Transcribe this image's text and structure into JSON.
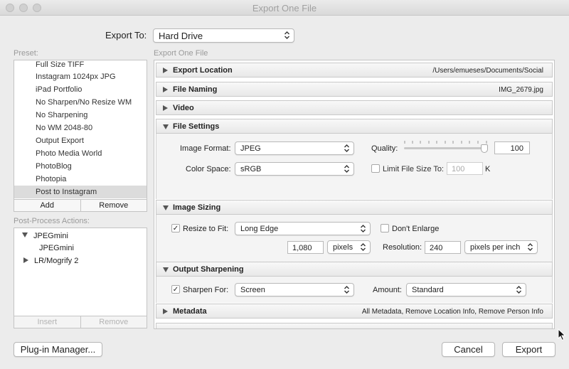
{
  "window": {
    "title": "Export One File"
  },
  "export_to": {
    "label": "Export To:",
    "value": "Hard Drive"
  },
  "preset": {
    "label": "Preset:",
    "items": [
      "Full Size TIFF",
      "Instagram 1024px JPG",
      "iPad Portfolio",
      "No Sharpen/No Resize WM",
      "No Sharpening",
      "No WM 2048-80",
      "Output Export",
      "Photo Media World",
      "PhotoBlog",
      "Photopia",
      "Post to Instagram"
    ],
    "selected": "Post to Instagram",
    "add_label": "Add",
    "remove_label": "Remove"
  },
  "post_process": {
    "label": "Post-Process Actions:",
    "items": [
      "JPEGmini",
      "JPEGmini",
      "LR/Mogrify 2"
    ],
    "insert_label": "Insert",
    "remove_label": "Remove"
  },
  "main": {
    "label": "Export One File",
    "sections": {
      "export_location": {
        "title": "Export Location",
        "summary": "/Users/emueses/Documents/Social"
      },
      "file_naming": {
        "title": "File Naming",
        "summary": "IMG_2679.jpg"
      },
      "video": {
        "title": "Video"
      },
      "file_settings": {
        "title": "File Settings",
        "image_format_label": "Image Format:",
        "image_format": "JPEG",
        "quality_label": "Quality:",
        "quality": "100",
        "quality_level": 1.0,
        "color_space_label": "Color Space:",
        "color_space": "sRGB",
        "limit_size_label": "Limit File Size To:",
        "limit_size_value": "100",
        "limit_size_unit": "K",
        "limit_size_checked": false
      },
      "image_sizing": {
        "title": "Image Sizing",
        "resize_label": "Resize to Fit:",
        "resize_checked": true,
        "resize_mode": "Long Edge",
        "dont_enlarge_label": "Don't Enlarge",
        "dont_enlarge_checked": false,
        "size_value": "1,080",
        "size_unit": "pixels",
        "resolution_label": "Resolution:",
        "resolution_value": "240",
        "resolution_unit": "pixels per inch"
      },
      "output_sharpening": {
        "title": "Output Sharpening",
        "sharpen_label": "Sharpen For:",
        "sharpen_checked": true,
        "sharpen_for": "Screen",
        "amount_label": "Amount:",
        "amount": "Standard"
      },
      "metadata": {
        "title": "Metadata",
        "summary": "All Metadata, Remove Location Info, Remove Person Info"
      }
    }
  },
  "footer": {
    "plugin_manager_label": "Plug-in Manager...",
    "cancel_label": "Cancel",
    "export_label": "Export"
  },
  "colors": {
    "background": "#ececec",
    "panel": "#ffffff",
    "selection": "#dcdcdc",
    "title_text": "#a0a0a0"
  }
}
